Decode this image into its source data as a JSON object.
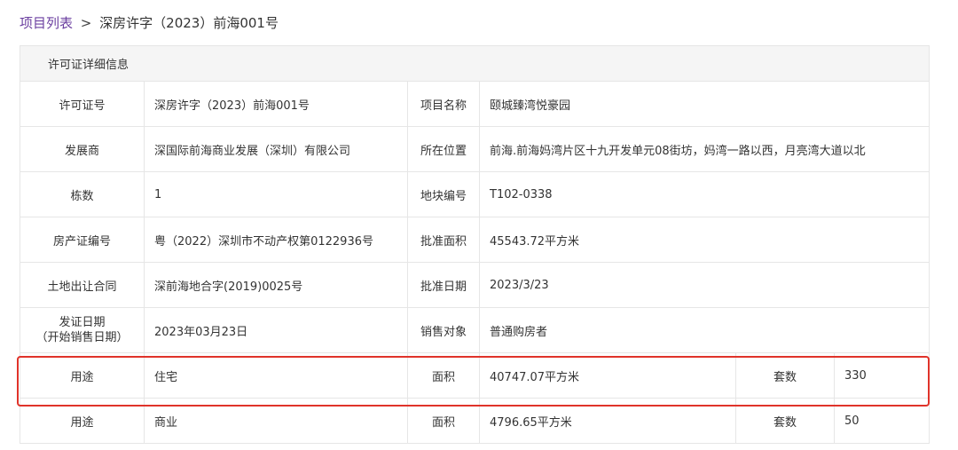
{
  "breadcrumb": {
    "link": "项目列表",
    "separator": ">",
    "current": "深房许字（2023）前海001号"
  },
  "table": {
    "header": "许可证详细信息",
    "rows": [
      {
        "l1": "许可证号",
        "v1": "深房许字（2023）前海001号",
        "l2": "项目名称",
        "v2": "颐城臻湾悦豪园"
      },
      {
        "l1": "发展商",
        "v1": "深国际前海商业发展（深圳）有限公司",
        "l2": "所在位置",
        "v2": "前海.前海妈湾片区十九开发单元08街坊，妈湾一路以西，月亮湾大道以北"
      },
      {
        "l1": "栋数",
        "v1": "1",
        "l2": "地块编号",
        "v2": "T102-0338"
      },
      {
        "l1": "房产证编号",
        "v1": "粤（2022）深圳市不动产权第0122936号",
        "l2": "批准面积",
        "v2": "45543.72平方米"
      },
      {
        "l1": "土地出让合同",
        "v1": "深前海地合字(2019)0025号",
        "l2": "批准日期",
        "v2": "2023/3/23"
      },
      {
        "l1_line1": "发证日期",
        "l1_line2": "（开始销售日期）",
        "v1": "2023年03月23日",
        "l2": "销售对象",
        "v2": "普通购房者"
      },
      {
        "l1": "用途",
        "v1": "住宅",
        "l2": "面积",
        "v2": "40747.07平方米",
        "l3": "套数",
        "v3": "330"
      },
      {
        "l1": "用途",
        "v1": "商业",
        "l2": "面积",
        "v2": "4796.65平方米",
        "l3": "套数",
        "v3": "50"
      }
    ]
  },
  "colors": {
    "link": "#6b3fa0",
    "highlight_border": "#e0332a",
    "header_bg": "#f5f5f5",
    "grid": "#e6e6e6"
  }
}
